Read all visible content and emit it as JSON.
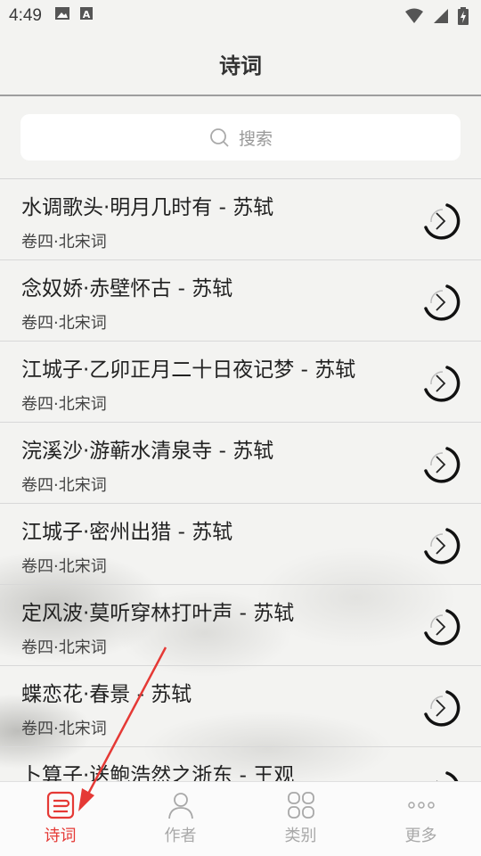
{
  "status_bar": {
    "time": "4:49"
  },
  "header": {
    "title": "诗词"
  },
  "search": {
    "placeholder": "搜索"
  },
  "poems": [
    {
      "title": "水调歌头·明月几时有 - 苏轼",
      "subtitle": "卷四·北宋词"
    },
    {
      "title": "念奴娇·赤壁怀古 - 苏轼",
      "subtitle": "卷四·北宋词"
    },
    {
      "title": "江城子·乙卯正月二十日夜记梦 - 苏轼",
      "subtitle": "卷四·北宋词"
    },
    {
      "title": "浣溪沙·游蕲水清泉寺 - 苏轼",
      "subtitle": "卷四·北宋词"
    },
    {
      "title": "江城子·密州出猎 - 苏轼",
      "subtitle": "卷四·北宋词"
    },
    {
      "title": "定风波·莫听穿林打叶声 - 苏轼",
      "subtitle": "卷四·北宋词"
    },
    {
      "title": "蝶恋花·春景 - 苏轼",
      "subtitle": "卷四·北宋词"
    },
    {
      "title": "卜算子·送鲍浩然之浙东 - 王观",
      "subtitle": ""
    }
  ],
  "tabs": [
    {
      "label": "诗词",
      "icon": "poems-icon",
      "active": true
    },
    {
      "label": "作者",
      "icon": "person-icon",
      "active": false
    },
    {
      "label": "类别",
      "icon": "category-icon",
      "active": false
    },
    {
      "label": "更多",
      "icon": "more-icon",
      "active": false
    }
  ],
  "colors": {
    "accent": "#e53935",
    "inactive": "#a8a8a8"
  }
}
